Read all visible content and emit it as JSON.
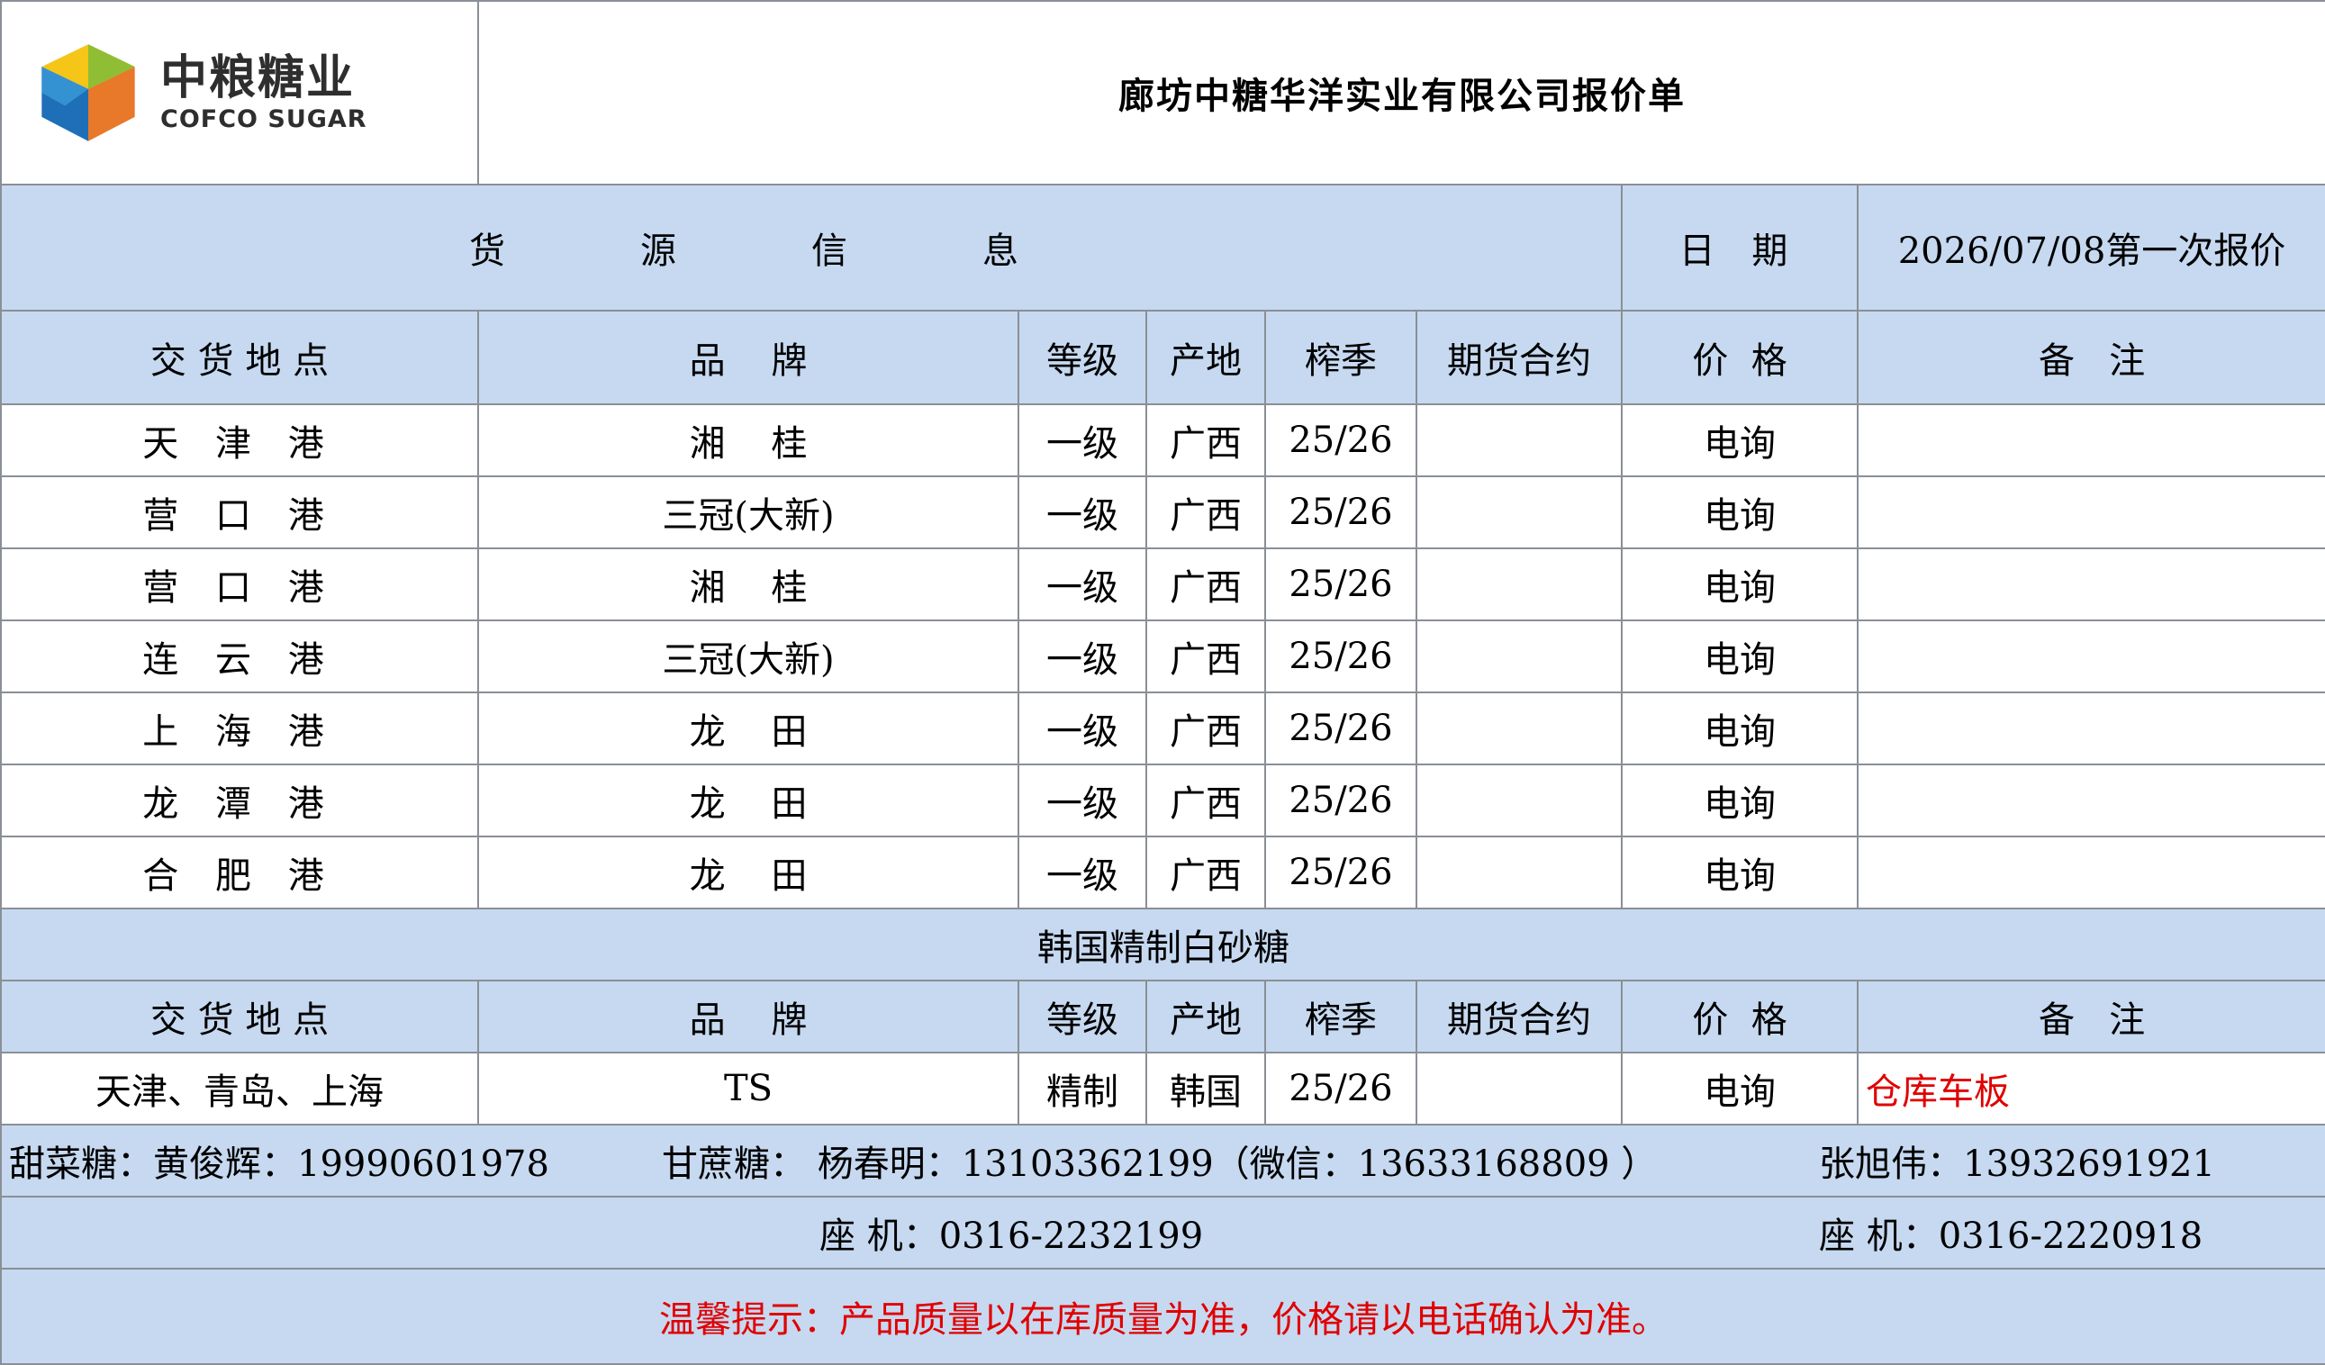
{
  "header": {
    "logo_cn": "中粮糖业",
    "logo_en": "COFCO SUGAR",
    "title": "廊坊中糖华洋实业有限公司报价单"
  },
  "info_row": {
    "source_label": "货源信息",
    "date_label": "日 期",
    "date_value": "2026/07/08第一次报价"
  },
  "columns": {
    "location": "交 货 地 点",
    "brand": "品    牌",
    "grade": "等级",
    "origin": "产地",
    "season": "榨季",
    "futures": "期货合约",
    "price": "价  格",
    "remark": "备   注"
  },
  "domestic_rows": [
    {
      "location": "天 津 港",
      "brand": "湘    桂",
      "grade": "一级",
      "origin": "广西",
      "season": "25/26",
      "futures": "",
      "price": "电询",
      "remark": ""
    },
    {
      "location": "营 口 港",
      "brand": "三冠(大新)",
      "grade": "一级",
      "origin": "广西",
      "season": "25/26",
      "futures": "",
      "price": "电询",
      "remark": ""
    },
    {
      "location": "营 口 港",
      "brand": "湘    桂",
      "grade": "一级",
      "origin": "广西",
      "season": "25/26",
      "futures": "",
      "price": "电询",
      "remark": ""
    },
    {
      "location": "连 云 港",
      "brand": "三冠(大新)",
      "grade": "一级",
      "origin": "广西",
      "season": "25/26",
      "futures": "",
      "price": "电询",
      "remark": ""
    },
    {
      "location": "上 海 港",
      "brand": "龙    田",
      "grade": "一级",
      "origin": "广西",
      "season": "25/26",
      "futures": "",
      "price": "电询",
      "remark": ""
    },
    {
      "location": "龙 潭 港",
      "brand": "龙    田",
      "grade": "一级",
      "origin": "广西",
      "season": "25/26",
      "futures": "",
      "price": "电询",
      "remark": ""
    },
    {
      "location": "合 肥 港",
      "brand": "龙    田",
      "grade": "一级",
      "origin": "广西",
      "season": "25/26",
      "futures": "",
      "price": "电询",
      "remark": ""
    }
  ],
  "korea_section": {
    "title": "韩国精制白砂糖",
    "row": {
      "location": "天津、青岛、上海",
      "brand": "TS",
      "grade": "精制",
      "origin": "韩国",
      "season": "25/26",
      "futures": "",
      "price": "电询",
      "remark": "仓库车板"
    }
  },
  "contacts": {
    "beet": "甜菜糖：黄俊辉：19990601978",
    "cane": "甘蔗糖： 杨春明：13103362199（微信：13633168809 ）",
    "zhang": "张旭伟：13932691921",
    "landline1": "座   机：0316-2232199",
    "landline2": "座   机：0316-2220918"
  },
  "notice": "温馨提示：产品质量以在库质量为准，价格请以电话确认为准。",
  "colors": {
    "header_blue": "#c6d9f0",
    "grid": "#8a8f96",
    "alert_red": "#e00000"
  }
}
